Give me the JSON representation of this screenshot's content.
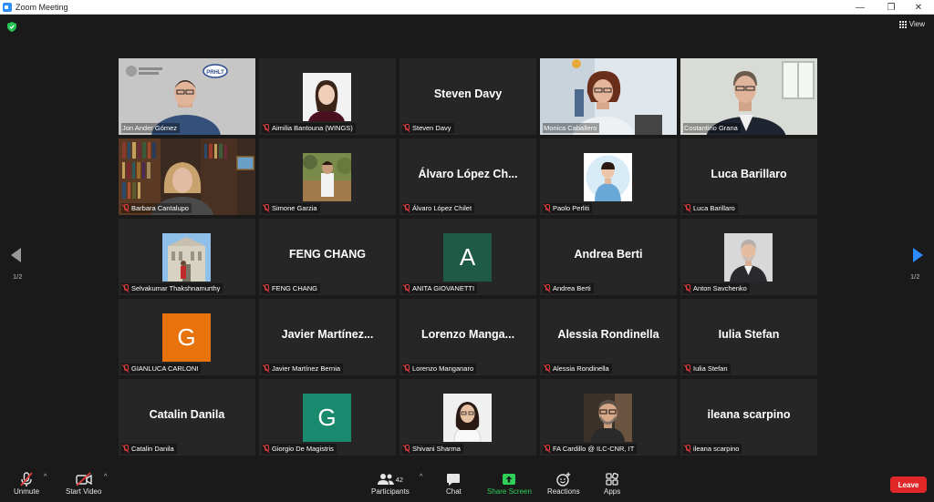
{
  "window": {
    "title": "Zoom Meeting",
    "minimize": "—",
    "maximize": "❐",
    "close": "✕"
  },
  "header": {
    "view_label": "View"
  },
  "pager": {
    "left_page": "1/2",
    "right_page": "1/2"
  },
  "participants": [
    {
      "name": "Jon Ander Gómez",
      "type": "video",
      "muted": false
    },
    {
      "name": "Aimilia Bantouna (WINGS)",
      "type": "photo",
      "muted": true
    },
    {
      "name": "Steven Davy",
      "display": "Steven Davy",
      "type": "name",
      "muted": true
    },
    {
      "name": "Monica Caballero",
      "type": "video",
      "muted": false
    },
    {
      "name": "Costantino Grana",
      "type": "video",
      "muted": false,
      "active_speaker": true
    },
    {
      "name": "Barbara Cantalupo",
      "type": "video",
      "muted": true
    },
    {
      "name": "Simone Garzia",
      "type": "photo",
      "muted": true
    },
    {
      "name": "Álvaro López Chilet",
      "display": "Álvaro López Ch...",
      "type": "name",
      "muted": true
    },
    {
      "name": "Paolo Perliti",
      "type": "photo",
      "muted": true
    },
    {
      "name": "Luca Barillaro",
      "display": "Luca Barillaro",
      "type": "name",
      "muted": true
    },
    {
      "name": "Selvakumar Thakshnamurthy",
      "type": "photo",
      "muted": true
    },
    {
      "name": "FENG CHANG",
      "display": "FENG CHANG",
      "type": "name",
      "muted": true
    },
    {
      "name": "ANITA GIOVANETTI",
      "letter": "A",
      "type": "letter",
      "color": "#1e5a45",
      "muted": true
    },
    {
      "name": "Andrea Berti",
      "display": "Andrea Berti",
      "type": "name",
      "muted": true
    },
    {
      "name": "Anton Savchenko",
      "type": "photo",
      "muted": true
    },
    {
      "name": "GIANLUCA CARLONI",
      "letter": "G",
      "type": "letter",
      "color": "#e8720c",
      "muted": true
    },
    {
      "name": "Javier Martínez Bernia",
      "display": "Javier  Martínez...",
      "type": "name",
      "muted": true
    },
    {
      "name": "Lorenzo Manganaro",
      "display": "Lorenzo  Manga...",
      "type": "name",
      "muted": true
    },
    {
      "name": "Alessia Rondinella",
      "display": "Alessia Rondinella",
      "type": "name",
      "muted": true
    },
    {
      "name": "Iulia Stefan",
      "display": "Iulia Stefan",
      "type": "name",
      "muted": true
    },
    {
      "name": "Catalin Danila",
      "display": "Catalin Danila",
      "type": "name",
      "muted": true
    },
    {
      "name": "Giorgio De Magistris",
      "letter": "G",
      "type": "letter",
      "color": "#1a8a6e",
      "muted": true
    },
    {
      "name": "Shivani Sharma",
      "type": "photo",
      "muted": true
    },
    {
      "name": "FA Cardillo @ ILC-CNR, IT",
      "type": "photo",
      "muted": true
    },
    {
      "name": "ileana scarpino",
      "display": "ileana scarpino",
      "type": "name",
      "muted": true
    }
  ],
  "toolbar": {
    "unmute": "Unmute",
    "start_video": "Start Video",
    "participants": "Participants",
    "participant_count": "42",
    "chat": "Chat",
    "share_screen": "Share Screen",
    "reactions": "Reactions",
    "apps": "Apps",
    "leave": "Leave"
  },
  "colors": {
    "share_green": "#2fd05a",
    "leave_red": "#e02828",
    "active_border": "#c8e07a",
    "nav_arrow": "#2d8cff"
  }
}
